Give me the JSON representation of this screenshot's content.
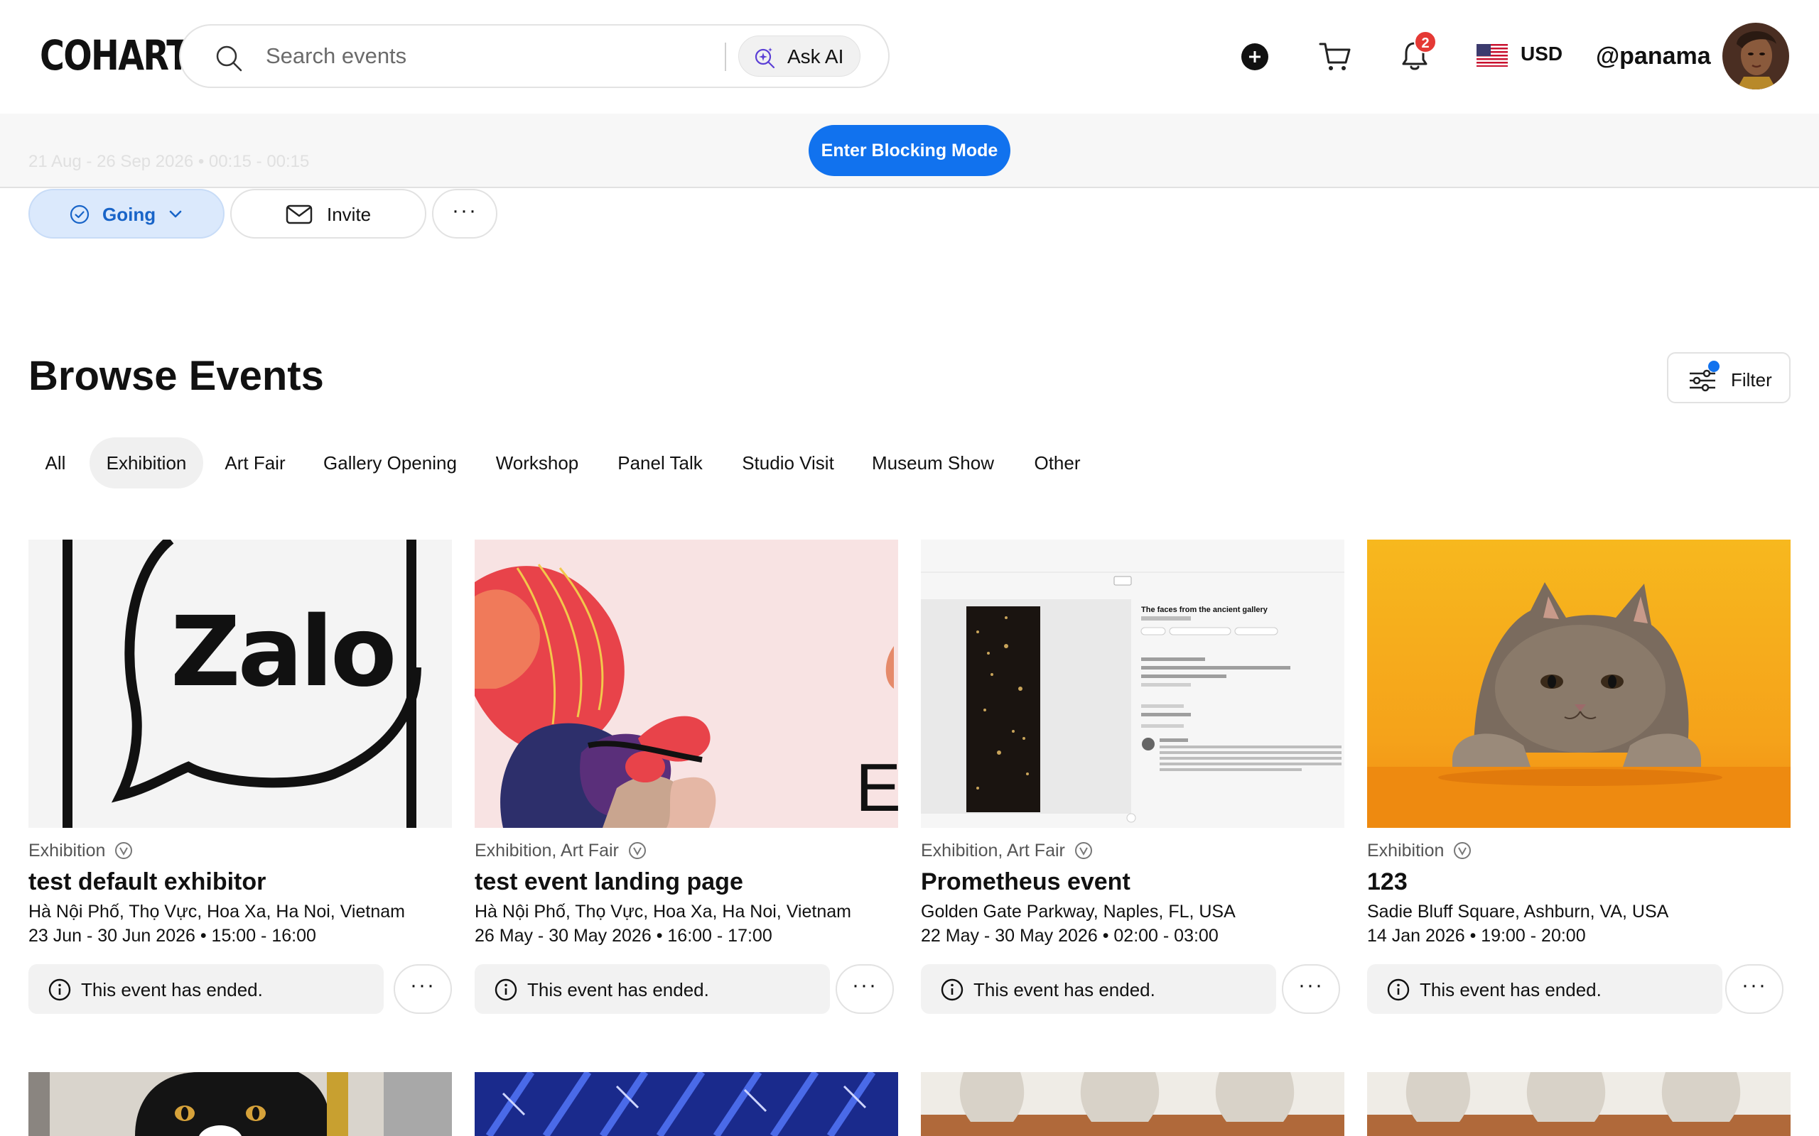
{
  "header": {
    "logo": "COHART",
    "search_placeholder": "Search events",
    "ask_ai_label": "Ask AI",
    "notification_count": "2",
    "currency": "USD",
    "username": "@panama"
  },
  "blocking": {
    "ghost_text": "21 Aug - 26 Sep 2026 • 00:15 - 00:15",
    "button_label": "Enter Blocking Mode"
  },
  "actions": {
    "going_label": "Going",
    "invite_label": "Invite",
    "more_label": "···"
  },
  "browse": {
    "title": "Browse Events",
    "filter_label": "Filter",
    "tabs": [
      {
        "label": "All",
        "active": false
      },
      {
        "label": "Exhibition",
        "active": true
      },
      {
        "label": "Art Fair",
        "active": false
      },
      {
        "label": "Gallery Opening",
        "active": false
      },
      {
        "label": "Workshop",
        "active": false
      },
      {
        "label": "Panel Talk",
        "active": false
      },
      {
        "label": "Studio Visit",
        "active": false
      },
      {
        "label": "Museum Show",
        "active": false
      },
      {
        "label": "Other",
        "active": false
      }
    ]
  },
  "events": [
    {
      "image": "zalo-logo",
      "image_text": "Zalo",
      "types": "Exhibition",
      "title": "test default exhibitor",
      "location": "Hà Nội Phố, Thọ Vực, Hoa Xa, Ha Noi, Vietnam",
      "date": "23 Jun - 30 Jun 2026 • 15:00 - 16:00",
      "status": "This event has ended."
    },
    {
      "image": "abstract-art",
      "image_text": "E",
      "types": "Exhibition, Art Fair",
      "title": "test event landing page",
      "location": "Hà Nội Phố, Thọ Vực, Hoa Xa, Ha Noi, Vietnam",
      "date": "26 May - 30 May 2026 • 16:00 - 17:00",
      "status": "This event has ended."
    },
    {
      "image": "artwork-screenshot",
      "image_text": "The faces from the ancient gallery",
      "types": "Exhibition, Art Fair",
      "title": "Prometheus event",
      "location": "Golden Gate Parkway, Naples, FL, USA",
      "date": "22 May - 30 May 2026 • 02:00 - 03:00",
      "status": "This event has ended."
    },
    {
      "image": "cat-photo",
      "image_text": "",
      "types": "Exhibition",
      "title": "123",
      "location": "Sadie Bluff Square, Ashburn, VA, USA",
      "date": "14 Jan 2026 • 19:00 - 20:00",
      "status": "This event has ended."
    }
  ],
  "colors": {
    "accent": "#1172ee",
    "going_bg": "#dbe9fc",
    "badge": "#e53935"
  }
}
